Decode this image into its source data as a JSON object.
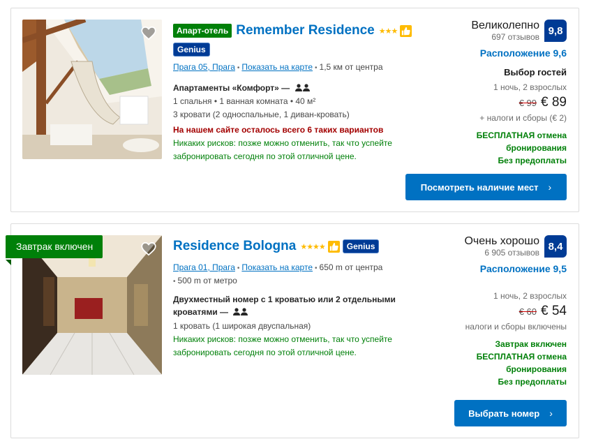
{
  "hotels": [
    {
      "type_badge": "Апарт-отель",
      "name": "Remember Residence",
      "stars": "★★★",
      "genius": "Genius",
      "district": "Прага 05, Прага",
      "show_map": "Показать на карте",
      "distance": "1,5 км от центра",
      "room_title": "Апартаменты «Комфорт» —",
      "room_details": [
        "1 спальня • 1 ванная комната • 40 м²",
        "3 кровати (2 односпальные, 1 диван-кровать)"
      ],
      "urgency": "На нашем сайте осталось всего 6 таких вариантов",
      "no_risk": "Никаких рисков: позже можно отменить, так что успейте забронировать сегодня по этой отличной цене.",
      "score_word": "Великолепно",
      "reviews": "697 отзывов",
      "score": "9,8",
      "location_score": "Расположение 9,6",
      "guest_choice": "Выбор гостей",
      "nights": "1 ночь, 2 взрослых",
      "old_price": "€ 99",
      "new_price": "€ 89",
      "taxes": "+ налоги и сборы (€ 2)",
      "free_cancel": "БЕСПЛАТНАЯ отмена бронирования",
      "no_prepay": "Без предоплаты",
      "button": "Посмотреть наличие мест"
    },
    {
      "ribbon": "Завтрак включен",
      "name": "Residence Bologna",
      "stars": "★★★★",
      "genius": "Genius",
      "district": "Прага 01, Прага",
      "show_map": "Показать на карте",
      "distance": "650 m от центра",
      "metro": "500 m от метро",
      "room_title": "Двухместный номер с 1 кроватью или 2 отдельными кроватями —",
      "room_details": [
        "1 кровать (1 широкая двуспальная)"
      ],
      "no_risk": "Никаких рисков: позже можно отменить, так что успейте забронировать сегодня по этой отличной цене.",
      "score_word": "Очень хорошо",
      "reviews": "6 905 отзывов",
      "score": "8,4",
      "location_score": "Расположение 9,5",
      "nights": "1 ночь, 2 взрослых",
      "old_price": "€ 60",
      "new_price": "€ 54",
      "taxes": "налоги и сборы включены",
      "breakfast": "Завтрак включен",
      "free_cancel": "БЕСПЛАТНАЯ отмена бронирования",
      "no_prepay": "Без предоплаты",
      "button": "Выбрать номер"
    }
  ],
  "colors": {
    "brand_blue": "#003b95",
    "link_blue": "#0071c2",
    "green": "#008009",
    "red": "#a30000",
    "star": "#febb02"
  },
  "icons": [
    "heart-icon",
    "thumbs-up-icon",
    "persons-icon",
    "chevron-right-icon"
  ]
}
